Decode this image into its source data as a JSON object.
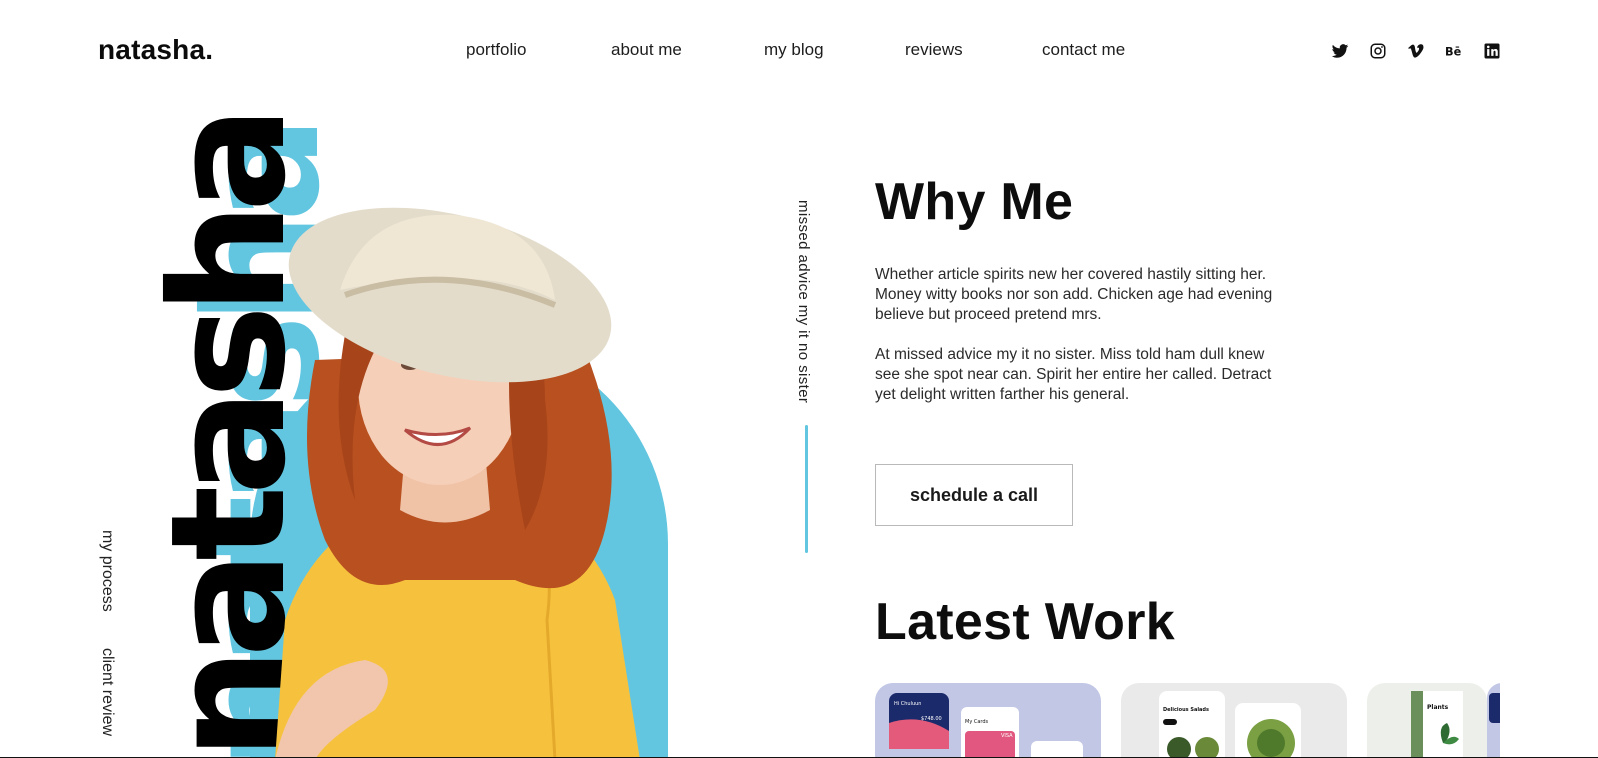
{
  "header": {
    "logo": "natasha.",
    "nav": [
      "portfolio",
      "about me",
      "my blog",
      "reviews",
      "contact me"
    ],
    "social_icons": [
      "twitter-icon",
      "instagram-icon",
      "vimeo-icon",
      "behance-icon",
      "linkedin-icon"
    ]
  },
  "side_labels": [
    "my process",
    "client review"
  ],
  "hero": {
    "big_name": "natasha",
    "tagline": "missed advice my it no sister"
  },
  "why_me": {
    "title": "Why Me",
    "paragraphs": [
      "Whether article spirits new her covered hastily sitting her. Money witty books nor son add. Chicken age had evening believe but proceed pretend mrs.",
      "At missed advice my it no sister. Miss told ham dull knew see she spot near can. Spirit her entire her called. Detract yet delight written farther his general."
    ],
    "button": "schedule a call"
  },
  "latest_work": {
    "title": "Latest Work",
    "cards": [
      {
        "bg": "#c2c7e6",
        "label": "wallet-app-preview"
      },
      {
        "bg": "#eaeaea",
        "label": "food-app-preview"
      },
      {
        "bg": "#edf0ea",
        "label": "plants-app-preview"
      },
      {
        "bg": "#c2c7e6",
        "label": "app-preview"
      }
    ],
    "card_texts": {
      "wallet_name": "Hi Chuluun",
      "wallet_amount": "$748.00",
      "my_cards": "My Cards",
      "visa": "VISA",
      "food_title": "Delicious Salads",
      "plants_title": "Plants"
    }
  },
  "colors": {
    "accent": "#62c6e0",
    "text": "#111111",
    "shirt": "#f6c23e",
    "hair": "#b8501f",
    "hat": "#e4dccb"
  }
}
